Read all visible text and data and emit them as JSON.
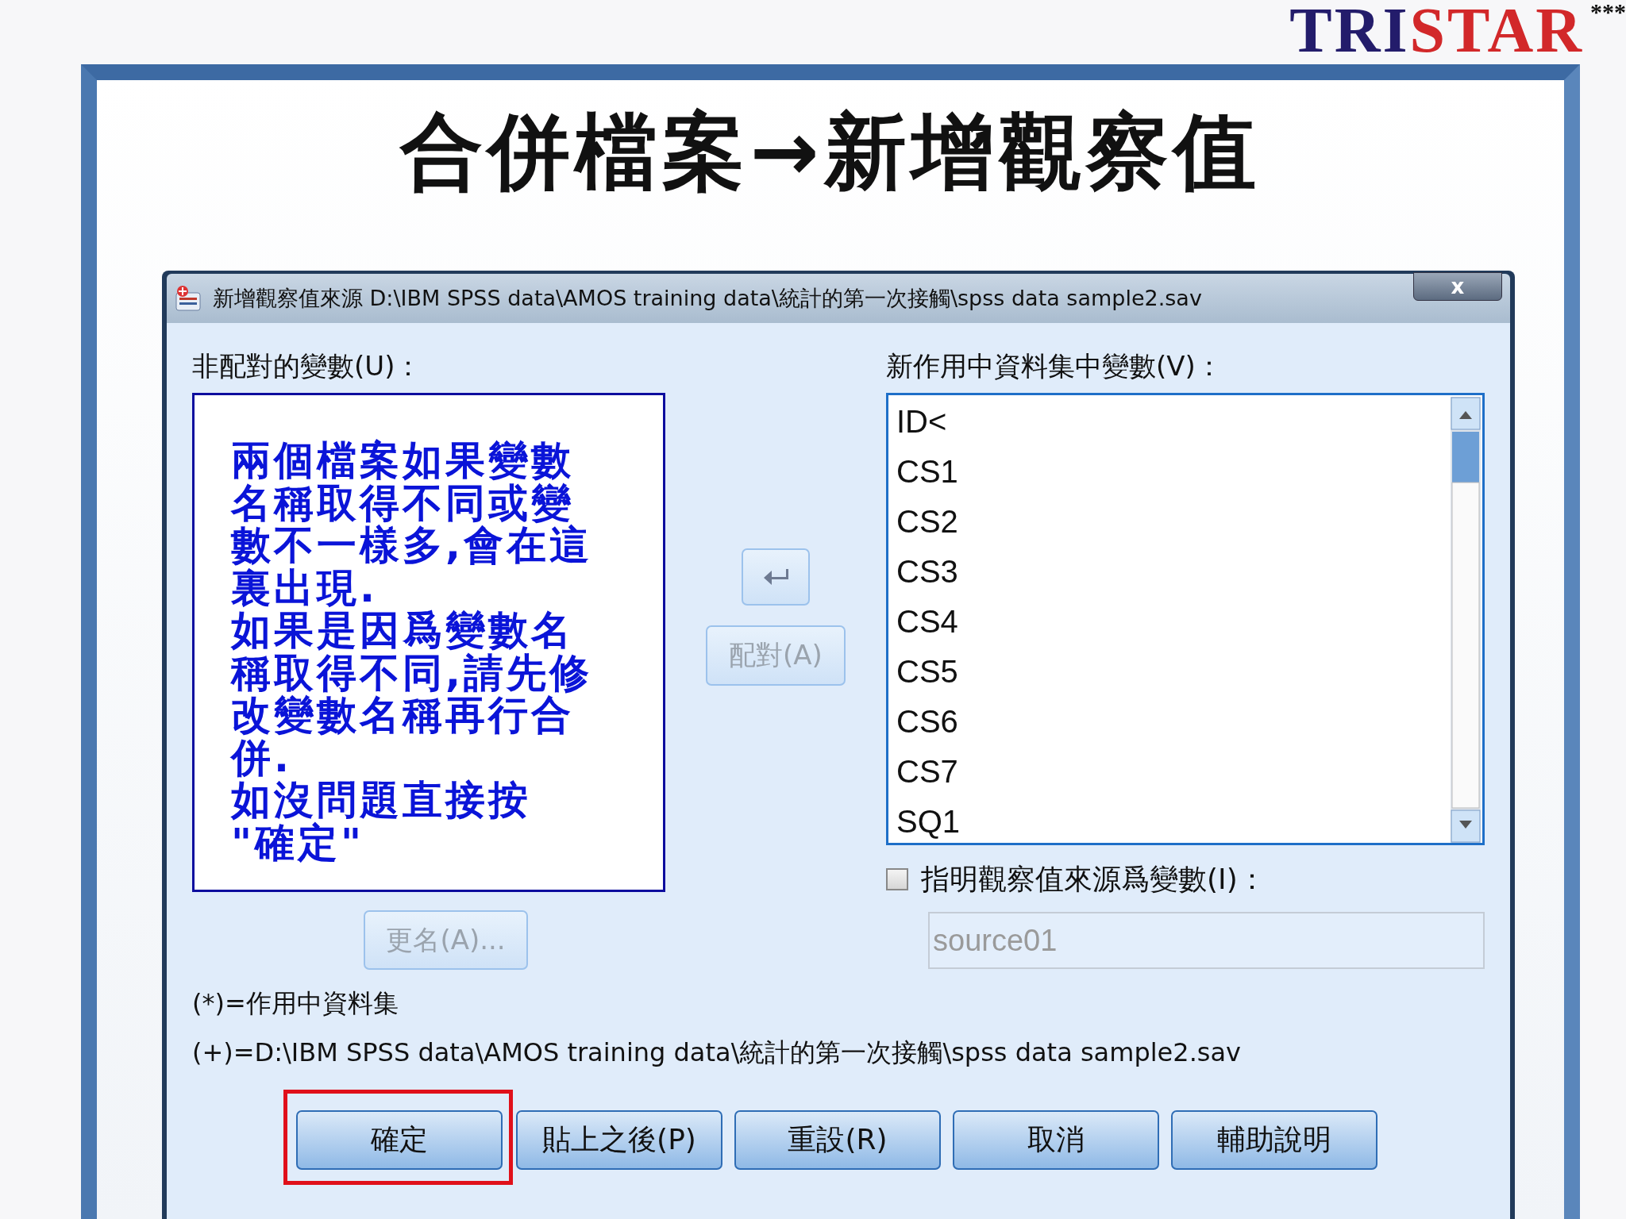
{
  "logo": {
    "parts": [
      {
        "text": "TRI",
        "color": "#231c6b"
      },
      {
        "text": "STAR",
        "color": "#d2282a"
      }
    ],
    "mark": "***"
  },
  "slide_title": "合併檔案→新增觀察值",
  "window": {
    "title": "新增觀察值來源 D:\\IBM SPSS data\\AMOS training data\\統計的第一次接觸\\spss data sample2.sav",
    "close": "x"
  },
  "unpaired": {
    "label": "非配對的變數(U)：",
    "note_lines": [
      "兩個檔案如果變數",
      "名稱取得不同或變",
      "數不一樣多,會在這",
      "裏出現.",
      "如果是因爲變數名",
      "稱取得不同,請先修",
      "改變數名稱再行合",
      "併.",
      "如沒問題直接按",
      "\"確定\""
    ]
  },
  "middle_buttons": [
    {
      "kind": "icon",
      "disabled": true
    },
    {
      "kind": "text",
      "label": "配對(A)",
      "disabled": true
    }
  ],
  "rename_button": {
    "label": "更名(A)...",
    "disabled": true
  },
  "new_variables": {
    "label": "新作用中資料集中變數(V)：",
    "items": [
      "ID<",
      "CS1",
      "CS2",
      "CS3",
      "CS4",
      "CS5",
      "CS6",
      "CS7",
      "SQ1"
    ]
  },
  "source_option": {
    "label": "指明觀察值來源爲變數(I)：",
    "checked": false,
    "value": "source01",
    "disabled": true
  },
  "legend": [
    "(*)=作用中資料集",
    "(+)=D:\\IBM SPSS data\\AMOS training data\\統計的第一次接觸\\spss data sample2.sav"
  ],
  "buttons": [
    {
      "label": "確定",
      "highlighted": true
    },
    {
      "label": "貼上之後(P)",
      "highlighted": false
    },
    {
      "label": "重設(R)",
      "highlighted": false
    },
    {
      "label": "取消",
      "highlighted": false
    },
    {
      "label": "輔助說明",
      "highlighted": false
    }
  ]
}
